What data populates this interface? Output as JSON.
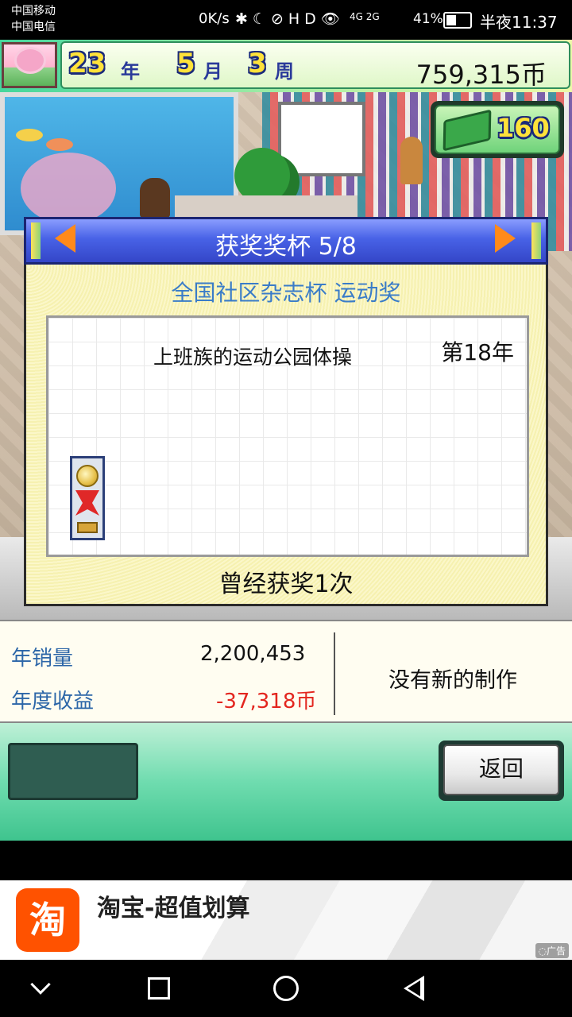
{
  "status_bar": {
    "carrier_1": "中国移动",
    "carrier_2": "中国电信",
    "net_speed": "0K/s",
    "status_icons": "✱☾⊘HD👁",
    "signal": "4G 2G",
    "battery_percent": "41%",
    "time": "半夜11:37"
  },
  "hud": {
    "year_num": "23",
    "year_unit": "年",
    "month_num": "5",
    "month_unit": "月",
    "week_num": "3",
    "week_unit": "周",
    "money": "759,315币",
    "research_points": "160",
    "icons": [
      "game-thumbnail",
      "money-book-icon"
    ]
  },
  "trophy_panel": {
    "header": "获奖奖杯 5/8",
    "award_name": "全国社区杂志杯 运动奖",
    "award_title": "上班族的运动公园体操",
    "award_year": "第18年",
    "award_count": "曾经获奖1次",
    "trophy_icon": "gold-medal-trophy"
  },
  "stats": {
    "annual_sales_label": "年销量",
    "annual_sales_value": "2,200,453",
    "annual_revenue_label": "年度收益",
    "annual_revenue_value": "-37,318币",
    "news_text": "没有新的制作",
    "revenue_color": "#e3261f",
    "label_color": "#2c66a8"
  },
  "buttons": {
    "back_label": "返回"
  },
  "ad": {
    "logo_text": "淘",
    "title": "淘宝-超值划算",
    "tag": "◌广告"
  },
  "colors": {
    "header_blue": "#4862e6",
    "accent_orange": "#ff8a1a",
    "money_yellow": "#ffe23a"
  }
}
